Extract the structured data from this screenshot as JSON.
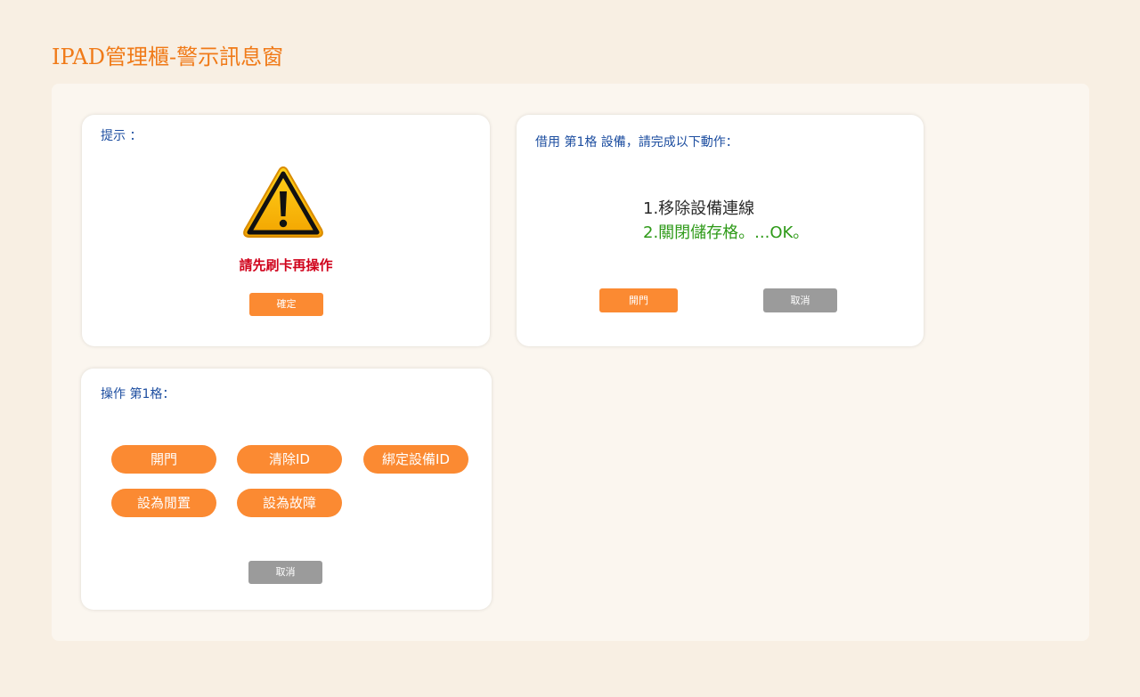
{
  "page": {
    "title": "IPAD管理櫃-警示訊息窗"
  },
  "alert": {
    "title": "提示 ：",
    "icon": "warning-icon",
    "message": "請先刷卡再操作",
    "confirm_label": "確定"
  },
  "borrow": {
    "title": "借用 第1格 設備，請完成以下動作：",
    "step1": "1.移除設備連線",
    "step2": "2.關閉儲存格。...OK。",
    "open_label": "開門",
    "cancel_label": "取消"
  },
  "operate": {
    "title": "操作 第1格：",
    "actions": [
      "開門",
      "清除ID",
      "綁定設備ID",
      "設為閒置",
      "設為故障"
    ],
    "cancel_label": "取消"
  },
  "colors": {
    "accent": "#fb8a32",
    "title": "#f07a18",
    "heading": "#1d4ea0",
    "alert_text": "#d0021b",
    "success_text": "#2e9a18",
    "neutral_button": "#9b9b9b"
  }
}
